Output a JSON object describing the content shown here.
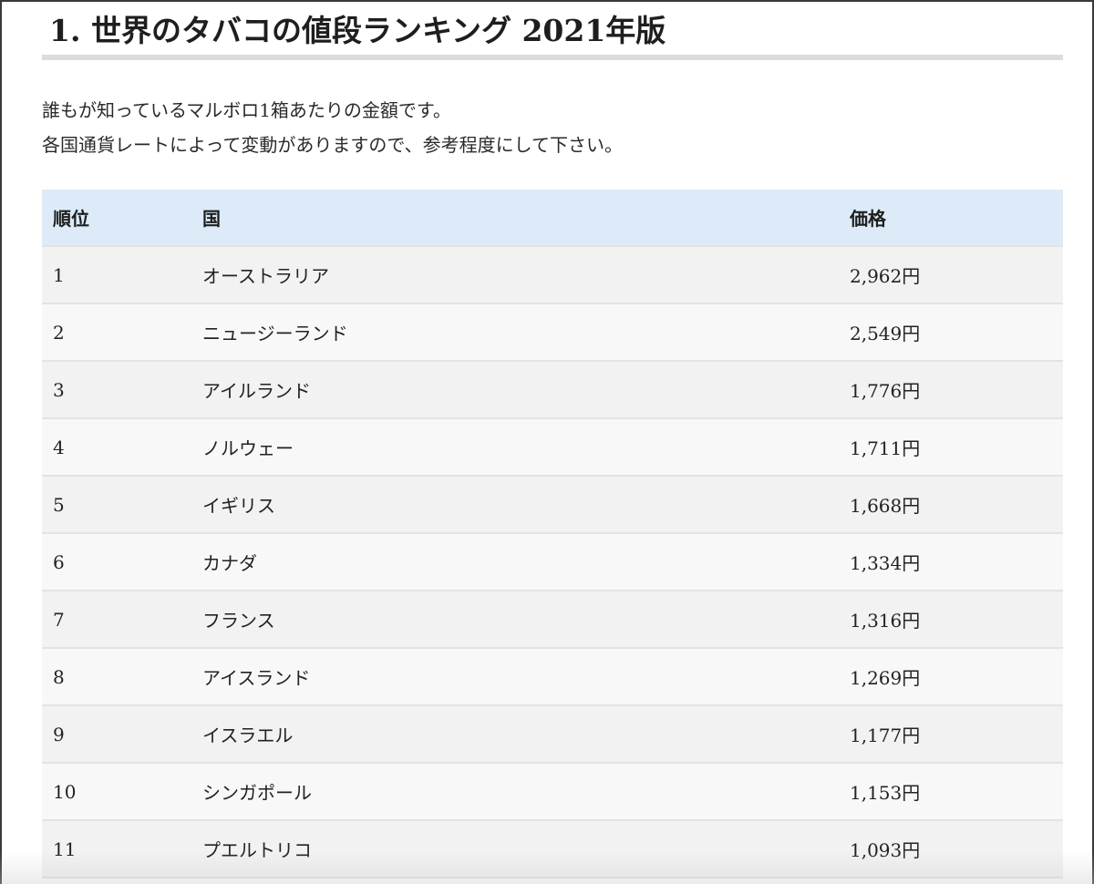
{
  "page": {
    "title": "1. 世界のタバコの値段ランキング 2021年版",
    "intro_lines": [
      "誰もが知っているマルボロ1箱あたりの金額です。",
      "各国通貨レートによって変動がありますので、参考程度にして下さい。"
    ]
  },
  "table": {
    "headers": {
      "rank": "順位",
      "country": "国",
      "price": "価格"
    },
    "rows": [
      {
        "rank": "1",
        "country": "オーストラリア",
        "price": "2,962円"
      },
      {
        "rank": "2",
        "country": "ニュージーランド",
        "price": "2,549円"
      },
      {
        "rank": "3",
        "country": "アイルランド",
        "price": "1,776円"
      },
      {
        "rank": "4",
        "country": "ノルウェー",
        "price": "1,711円"
      },
      {
        "rank": "5",
        "country": "イギリス",
        "price": "1,668円"
      },
      {
        "rank": "6",
        "country": "カナダ",
        "price": "1,334円"
      },
      {
        "rank": "7",
        "country": "フランス",
        "price": "1,316円"
      },
      {
        "rank": "8",
        "country": "アイスランド",
        "price": "1,269円"
      },
      {
        "rank": "9",
        "country": "イスラエル",
        "price": "1,177円"
      },
      {
        "rank": "10",
        "country": "シンガポール",
        "price": "1,153円"
      },
      {
        "rank": "11",
        "country": "プエルトリコ",
        "price": "1,093円"
      }
    ]
  },
  "colors": {
    "header_bg": "#dcebf7",
    "row_odd_bg": "#f2f2f2",
    "row_even_bg": "#f8f8f8",
    "title_rule": "#dcdcdc",
    "text": "#222222"
  }
}
